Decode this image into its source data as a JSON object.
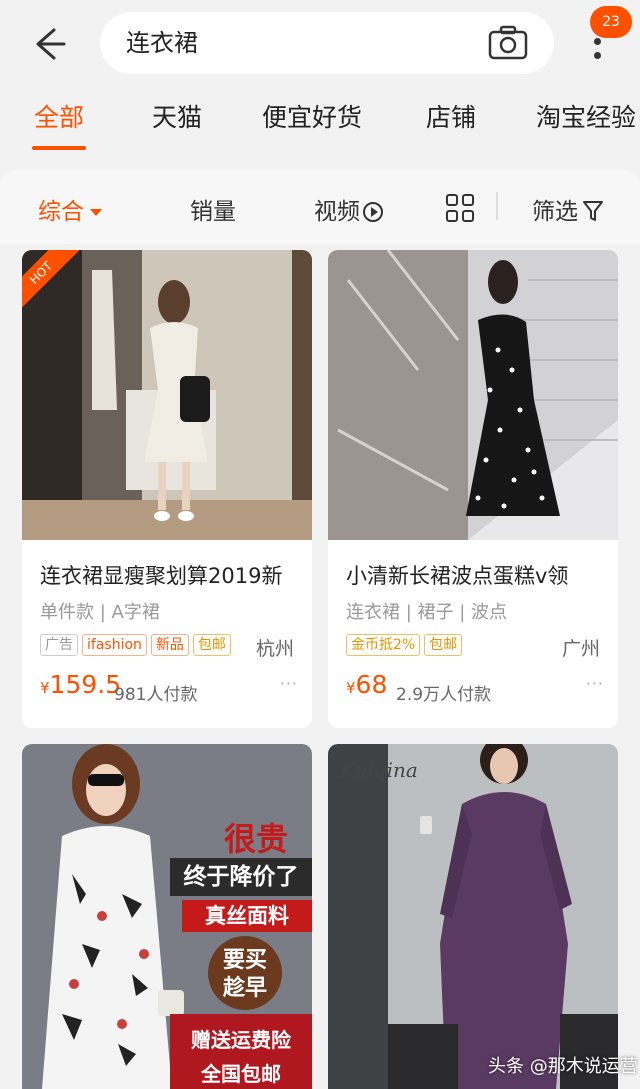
{
  "search": {
    "query": "连衣裙",
    "badge_count": "23"
  },
  "tabs": [
    {
      "label": "全部"
    },
    {
      "label": "天猫"
    },
    {
      "label": "便宜好货"
    },
    {
      "label": "店铺"
    },
    {
      "label": "淘宝经验"
    }
  ],
  "sort": {
    "overall": "综合",
    "sales": "销量",
    "video": "视频",
    "filter": "筛选"
  },
  "products": [
    {
      "badge": "HOT",
      "title": "连衣裙显瘦聚划算2019新",
      "attrs": "单件款 | A字裙",
      "tags": [
        "广告",
        "ifashion",
        "新品",
        "包邮"
      ],
      "location": "杭州",
      "currency": "¥",
      "price": "159.5",
      "sold": "981人付款"
    },
    {
      "title": "小清新长裙波点蛋糕v领",
      "attrs": "连衣裙 | 裙子 | 波点",
      "tags": [
        "金币抵2%",
        "包邮"
      ],
      "location": "广州",
      "currency": "¥",
      "price": "68",
      "sold": "2.9万人付款"
    },
    {
      "banner": [
        "很贵",
        "终于降价了",
        "真丝面料",
        "要买",
        "趁早",
        "赠送运费险",
        "全国包邮"
      ]
    },
    {
      "brand": "Kuiqina"
    }
  ],
  "watermark": "头条 @那木说运营",
  "colors": {
    "accent": "#ff5000",
    "background": "#f2f2f2"
  }
}
